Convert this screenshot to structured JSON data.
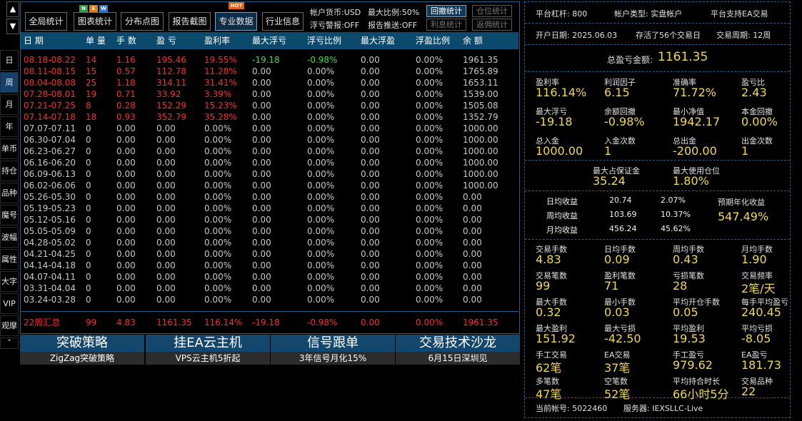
{
  "arrows": {
    "up": "▲",
    "down": "▼"
  },
  "nav": [
    "日",
    "周",
    "月",
    "年",
    "单币",
    "持仓",
    "品种",
    "魔号",
    "波幅",
    "属性",
    "大字",
    "VIP",
    "观摩",
    "˅"
  ],
  "toolbar": {
    "buttons": [
      "全局统计",
      "图表统计",
      "分布点图",
      "报告截图",
      "专业数据",
      "行业信息"
    ],
    "badges": {
      "n": "N",
      "e": "E",
      "w": "W",
      "hot": "HOT"
    },
    "currency": "帐户货币:USD",
    "float_alert": "浮亏警报:OFF",
    "max_ratio": "最大比例:50%",
    "report_push": "报告推送:OFF",
    "small_buttons": [
      "回撤统计",
      "仓位统计",
      "利息统计",
      "返佣统计"
    ]
  },
  "table": {
    "headers": [
      "日 期",
      "单 量",
      "手 数",
      "盈 亏",
      "盈利率",
      "最大浮亏",
      "浮亏比例",
      "最大浮盈",
      "浮盈比例",
      "余 额"
    ],
    "rows": [
      [
        "08.18-08.22",
        "14",
        "1.16",
        "195.46",
        "19.55%",
        "-19.18",
        "-0.98%",
        "0.00",
        "0.00%",
        "1961.35"
      ],
      [
        "08.11-08.15",
        "15",
        "0.57",
        "112.78",
        "11.28%",
        "0.00",
        "0.00%",
        "0.00",
        "0.00%",
        "1765.89"
      ],
      [
        "08.04-08.08",
        "25",
        "1.18",
        "314.11",
        "31.41%",
        "0.00",
        "0.00%",
        "0.00",
        "0.00%",
        "1653.11"
      ],
      [
        "07.28-08.01",
        "19",
        "0.71",
        "33.92",
        "3.39%",
        "0.00",
        "0.00%",
        "0.00",
        "0.00%",
        "1539.00"
      ],
      [
        "07.21-07.25",
        "8",
        "0.28",
        "152.29",
        "15.23%",
        "0.00",
        "0.00%",
        "0.00",
        "0.00%",
        "1505.08"
      ],
      [
        "07.14-07.18",
        "18",
        "0.93",
        "352.79",
        "35.28%",
        "0.00",
        "0.00%",
        "0.00",
        "0.00%",
        "1352.79"
      ],
      [
        "07.07-07.11",
        "0",
        "0.00",
        "0.00",
        "0.00%",
        "0.00",
        "0.00%",
        "0.00",
        "0.00%",
        "1000.00"
      ],
      [
        "06.30-07.04",
        "0",
        "0.00",
        "0.00",
        "0.00%",
        "0.00",
        "0.00%",
        "0.00",
        "0.00%",
        "1000.00"
      ],
      [
        "06.23-06.27",
        "0",
        "0.00",
        "0.00",
        "0.00%",
        "0.00",
        "0.00%",
        "0.00",
        "0.00%",
        "1000.00"
      ],
      [
        "06.16-06.20",
        "0",
        "0.00",
        "0.00",
        "0.00%",
        "0.00",
        "0.00%",
        "0.00",
        "0.00%",
        "1000.00"
      ],
      [
        "06.09-06.13",
        "0",
        "0.00",
        "0.00",
        "0.00%",
        "0.00",
        "0.00%",
        "0.00",
        "0.00%",
        "1000.00"
      ],
      [
        "06.02-06.06",
        "0",
        "0.00",
        "0.00",
        "0.00%",
        "0.00",
        "0.00%",
        "0.00",
        "0.00%",
        "1000.00"
      ],
      [
        "05.26-05.30",
        "0",
        "0.00",
        "0.00",
        "0.00%",
        "0.00",
        "0.00%",
        "0.00",
        "0.00%",
        "0.00"
      ],
      [
        "05.19-05.23",
        "0",
        "0.00",
        "0.00",
        "0.00%",
        "0.00",
        "0.00%",
        "0.00",
        "0.00%",
        "0.00"
      ],
      [
        "05.12-05.16",
        "0",
        "0.00",
        "0.00",
        "0.00%",
        "0.00",
        "0.00%",
        "0.00",
        "0.00%",
        "0.00"
      ],
      [
        "05.05-05.09",
        "0",
        "0.00",
        "0.00",
        "0.00%",
        "0.00",
        "0.00%",
        "0.00",
        "0.00%",
        "0.00"
      ],
      [
        "04.28-05.02",
        "0",
        "0.00",
        "0.00",
        "0.00%",
        "0.00",
        "0.00%",
        "0.00",
        "0.00%",
        "0.00"
      ],
      [
        "04.21-04.25",
        "0",
        "0.00",
        "0.00",
        "0.00%",
        "0.00",
        "0.00%",
        "0.00",
        "0.00%",
        "0.00"
      ],
      [
        "04.14-04.18",
        "0",
        "0.00",
        "0.00",
        "0.00%",
        "0.00",
        "0.00%",
        "0.00",
        "0.00%",
        "0.00"
      ],
      [
        "04.07-04.11",
        "0",
        "0.00",
        "0.00",
        "0.00%",
        "0.00",
        "0.00%",
        "0.00",
        "0.00%",
        "0.00"
      ],
      [
        "03.31-04.04",
        "0",
        "0.00",
        "0.00",
        "0.00%",
        "0.00",
        "0.00%",
        "0.00",
        "0.00%",
        "0.00"
      ],
      [
        "03.24-03.28",
        "0",
        "0.00",
        "0.00",
        "0.00%",
        "0.00",
        "0.00%",
        "0.00",
        "0.00%",
        "0.00"
      ]
    ],
    "highlight_rows": 6,
    "summary": [
      "22周汇总",
      "99",
      "4.83",
      "1161.35",
      "116.14%",
      "-19.18",
      "-0.98%",
      "0.00",
      "0.00%",
      "1961.35"
    ]
  },
  "banners": [
    {
      "title": "突破策略",
      "sub": "ZigZag突破策略"
    },
    {
      "title": "挂EA云主机",
      "sub": "VPS云主机5折起"
    },
    {
      "title": "信号跟单",
      "sub": "3年信号月化15%"
    },
    {
      "title": "交易技术沙龙",
      "sub": "6月15日深圳见"
    }
  ],
  "right": {
    "leverage": "平台杠杆:  800",
    "acct_type": "帐户类型:  实盘帐户",
    "ea_support": "平台支持EA交易",
    "open_date": "开户日期:  2025.06.03",
    "survived": "存活了56个交易日",
    "period": "交易周期:  12周",
    "total_label": "总盈亏金额:",
    "total_value": "1161.35",
    "grid1": [
      {
        "l": "盈利率",
        "v": "116.14%"
      },
      {
        "l": "利润因子",
        "v": "6.15"
      },
      {
        "l": "准确率",
        "v": "71.72%"
      },
      {
        "l": "盈亏比",
        "v": "2.43"
      },
      {
        "l": "最大浮亏",
        "v": "-19.18"
      },
      {
        "l": "余额回撤",
        "v": "-0.98%"
      },
      {
        "l": "最小净值",
        "v": "1942.17"
      },
      {
        "l": "本金回撤",
        "v": "0.00%"
      },
      {
        "l": "总入金",
        "v": "1000.00"
      },
      {
        "l": "入金次数",
        "v": "1"
      },
      {
        "l": "总出金",
        "v": "-200.00"
      },
      {
        "l": "出金次数",
        "v": "1"
      }
    ],
    "margin": [
      {
        "l": "最大占保证金",
        "v": "35.24"
      },
      {
        "l": "最大使用仓位",
        "v": "1.80%"
      }
    ],
    "daily": [
      {
        "l": "日均收益",
        "a": "20.74",
        "b": "2.07%"
      },
      {
        "l": "周均收益",
        "a": "103.69",
        "b": "10.37%"
      },
      {
        "l": "月均收益",
        "a": "456.24",
        "b": "45.62%"
      }
    ],
    "annual_label": "预期年化收益",
    "annual_value": "547.49%",
    "grid2": [
      {
        "l": "交易手数",
        "v": "4.83"
      },
      {
        "l": "日均手数",
        "v": "0.09"
      },
      {
        "l": "周均手数",
        "v": "0.43"
      },
      {
        "l": "月均手数",
        "v": "1.90"
      },
      {
        "l": "交易笔数",
        "v": "99"
      },
      {
        "l": "盈利笔数",
        "v": "71"
      },
      {
        "l": "亏损笔数",
        "v": "28"
      },
      {
        "l": "交易频率",
        "v": "2笔/天"
      },
      {
        "l": "最大手数",
        "v": "0.32"
      },
      {
        "l": "最小手数",
        "v": "0.03"
      },
      {
        "l": "平均开仓手数",
        "v": "0.05"
      },
      {
        "l": "每手平均盈亏",
        "v": "240.45"
      },
      {
        "l": "最大盈利",
        "v": "151.92"
      },
      {
        "l": "最大亏损",
        "v": "-42.50"
      },
      {
        "l": "平均盈利",
        "v": "19.53"
      },
      {
        "l": "平均亏损",
        "v": "-8.05"
      },
      {
        "l": "手工交易",
        "v": "62笔"
      },
      {
        "l": "EA交易",
        "v": "37笔"
      },
      {
        "l": "手工盈亏",
        "v": "979.62"
      },
      {
        "l": "EA盈亏",
        "v": "181.73"
      },
      {
        "l": "多笔数",
        "v": "47笔"
      },
      {
        "l": "空笔数",
        "v": "52笔"
      },
      {
        "l": "平均持合时长",
        "v": "66小时5分"
      },
      {
        "l": "交易品种",
        "v": "22"
      }
    ],
    "account": "当前帐号:  5022460",
    "server": "服务器:  IEXSLLC-Live"
  },
  "colors": {
    "red": "#ff2a2a",
    "green": "#39e03a",
    "yellow": "#f1d94a",
    "grey": "#c8c8c8",
    "header": "#0b4a6b"
  }
}
